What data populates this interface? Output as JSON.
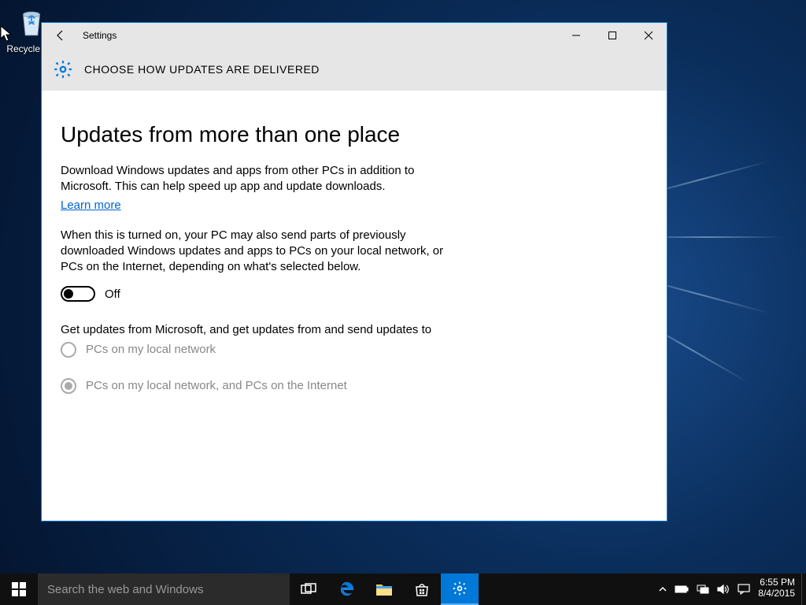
{
  "desktop": {
    "recycle_bin": "Recycle Bin"
  },
  "window": {
    "app_title": "Settings",
    "header": "CHOOSE HOW UPDATES ARE DELIVERED",
    "heading": "Updates from more than one place",
    "desc1": "Download Windows updates and apps from other PCs in addition to Microsoft. This can help speed up app and update downloads.",
    "learn_more": "Learn more",
    "desc2": "When this is turned on, your PC may also send parts of previously downloaded Windows updates and apps to PCs on your local network, or PCs on the Internet, depending on what's selected below.",
    "toggle_state": "Off",
    "subtext": "Get updates from Microsoft, and get updates from and send updates to",
    "radio1": "PCs on my local network",
    "radio2": "PCs on my local network, and PCs on the Internet"
  },
  "taskbar": {
    "search_placeholder": "Search the web and Windows",
    "time": "6:55 PM",
    "date": "8/4/2015"
  }
}
